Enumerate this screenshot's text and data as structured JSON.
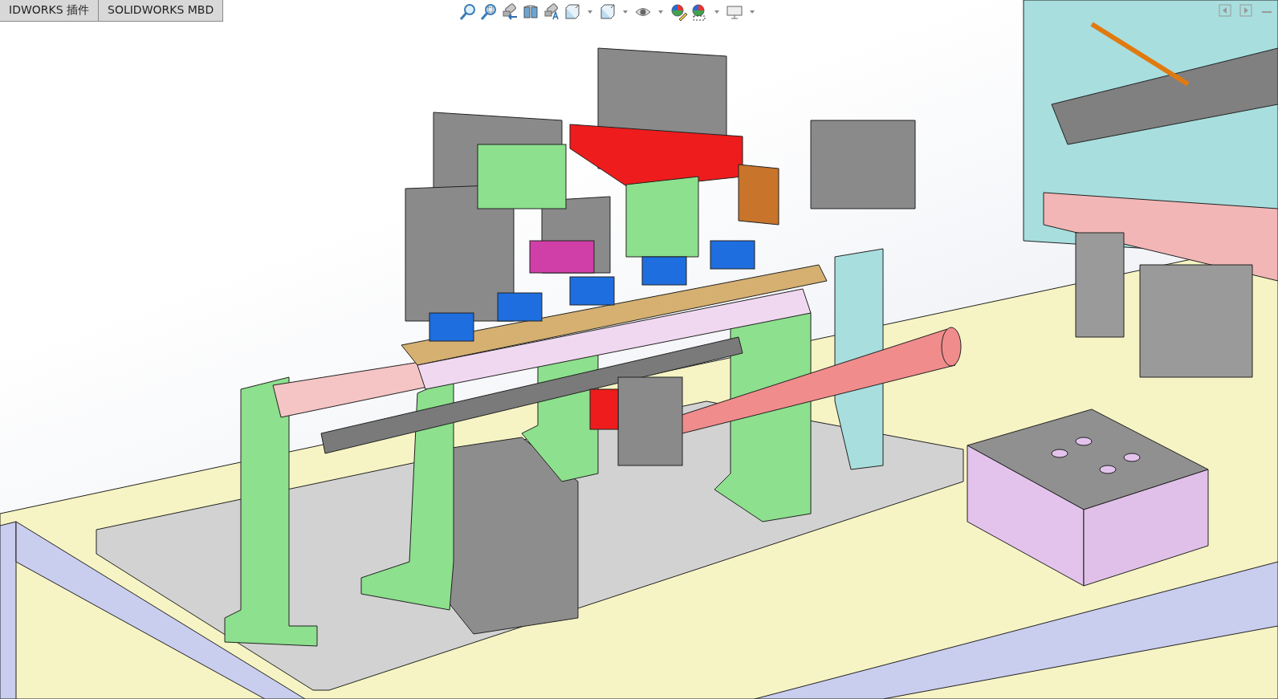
{
  "tabs": [
    {
      "label": "IDWORKS 插件",
      "selected": false
    },
    {
      "label": "SOLIDWORKS MBD",
      "selected": false
    }
  ],
  "view_toolbar": [
    {
      "kind": "magnifier"
    },
    {
      "kind": "zoombox"
    },
    {
      "kind": "binoculars"
    },
    {
      "kind": "section"
    },
    {
      "kind": "annotation"
    },
    {
      "kind": "cube"
    },
    {
      "kind": "caret"
    },
    {
      "kind": "box"
    },
    {
      "kind": "caret"
    },
    {
      "kind": "eye"
    },
    {
      "kind": "caret"
    },
    {
      "kind": "palette"
    },
    {
      "kind": "scene"
    },
    {
      "kind": "caret"
    },
    {
      "kind": "monitor"
    },
    {
      "kind": "caret"
    }
  ],
  "window_controls": [
    {
      "kind": "left"
    },
    {
      "kind": "right"
    },
    {
      "kind": "minimize"
    }
  ]
}
